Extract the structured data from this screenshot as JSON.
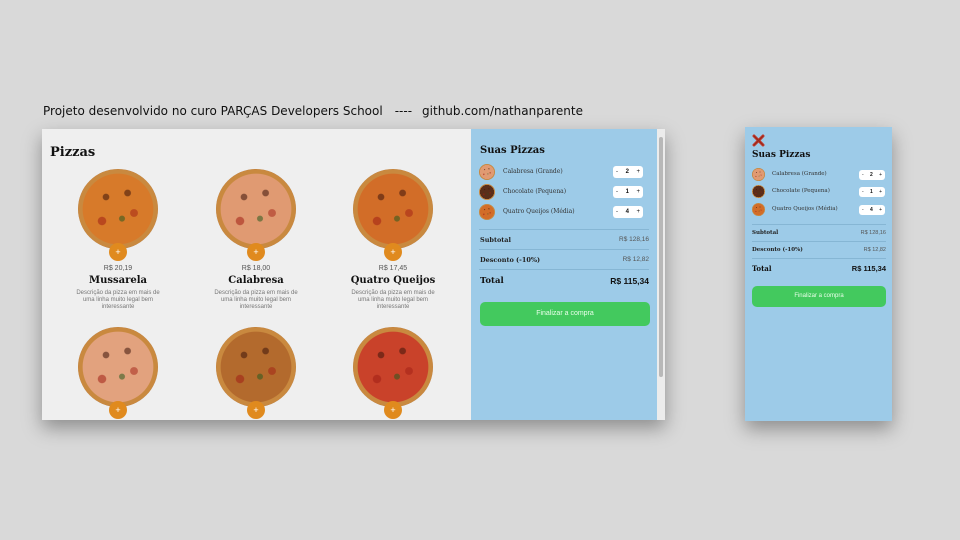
{
  "caption": {
    "project": "Projeto desenvolvido no curo PARÇAS Developers School",
    "separator": "----",
    "link": "github.com/nathanparente"
  },
  "menu": {
    "title": "Pizzas",
    "add_label": "+",
    "items": [
      {
        "name": "Mussarela",
        "price": "R$ 20,19",
        "desc": "Descrição da pizza em mais de uma linha muito legal bem interessante",
        "color": "#d77a2a"
      },
      {
        "name": "Calabresa",
        "price": "R$ 18,00",
        "desc": "Descrição da pizza em mais de uma linha muito legal bem interessante",
        "color": "#e09a72"
      },
      {
        "name": "Quatro Queijos",
        "price": "R$ 17,45",
        "desc": "Descrição da pizza em mais de uma linha muito legal bem interessante",
        "color": "#d26d28"
      },
      {
        "name": "",
        "price": "",
        "desc": "",
        "color": "#e2a27e"
      },
      {
        "name": "",
        "price": "",
        "desc": "",
        "color": "#b36a2d"
      },
      {
        "name": "",
        "price": "",
        "desc": "",
        "color": "#c9422a"
      }
    ]
  },
  "cart": {
    "title": "Suas Pizzas",
    "items": [
      {
        "name": "Calabresa (Grande)",
        "qty": "2",
        "minus": "-",
        "plus": "+",
        "color": "#e09a72"
      },
      {
        "name": "Chocolate (Pequena)",
        "qty": "1",
        "minus": "-",
        "plus": "+",
        "color": "#5a2e1a"
      },
      {
        "name": "Quatro Queijos (Média)",
        "qty": "4",
        "minus": "-",
        "plus": "+",
        "color": "#d26d28"
      }
    ],
    "subtotal_label": "Subtotal",
    "subtotal_value": "R$ 128,16",
    "discount_label": "Desconto (-10%)",
    "discount_value": "R$ 12,82",
    "total_label": "Total",
    "total_value": "R$ 115,34",
    "finish_label": "Finalizar a compra"
  },
  "colors": {
    "cart_bg": "#9dcbe8",
    "button_green": "#43c95e",
    "add_orange": "#e08a1e",
    "close_red": "#c0392b"
  }
}
